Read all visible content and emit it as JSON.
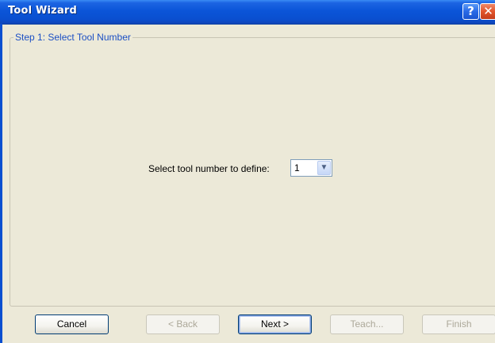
{
  "window": {
    "title": "Tool Wizard",
    "help_glyph": "?",
    "close_glyph": "✕"
  },
  "step": {
    "group_label": "Step 1: Select Tool Number",
    "field_label": "Select tool number to define:",
    "tool_number_selected": "1",
    "dropdown_glyph": "▼"
  },
  "buttons": {
    "cancel": "Cancel",
    "back": "< Back",
    "next": "Next >",
    "teach": "Teach...",
    "finish": "Finish"
  },
  "colors": {
    "titlebar": "#0a4fd0",
    "dialog_bg": "#ece9d8",
    "group_label": "#1b4fc4"
  }
}
